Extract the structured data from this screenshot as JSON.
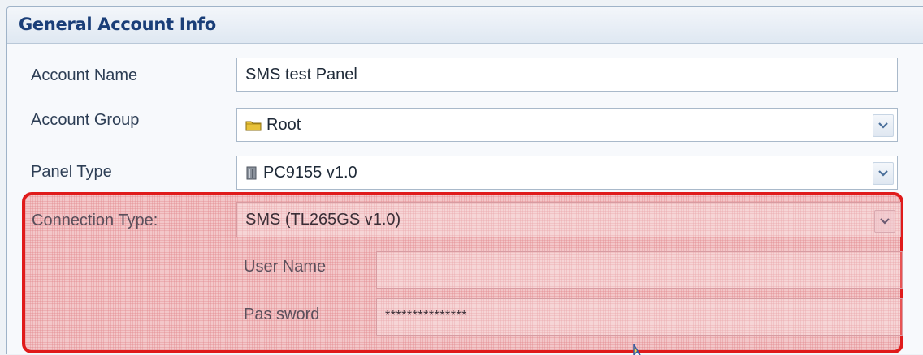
{
  "header": {
    "title": "General Account Info"
  },
  "fields": {
    "account_name": {
      "label": "Account Name",
      "value": "SMS test Panel"
    },
    "account_group": {
      "label": "Account Group",
      "value": "Root",
      "icon": "folder-icon"
    },
    "panel_type": {
      "label": "Panel Type",
      "value": "PC9155 v1.0",
      "icon": "panel-device-icon"
    },
    "connection_type": {
      "label": "Connection Type:",
      "value": "SMS   (TL265GS v1.0)"
    },
    "user_name": {
      "label": "User Name",
      "value": ""
    },
    "password": {
      "label": "Pas sword",
      "value": "***************"
    }
  },
  "colors": {
    "header_text": "#1a3e78",
    "highlight_border": "#e01b1b",
    "highlight_fill": "#f3c7c9"
  }
}
